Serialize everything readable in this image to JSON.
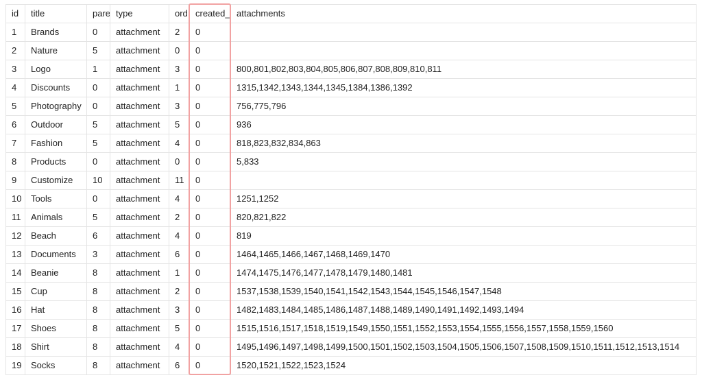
{
  "table": {
    "columns": [
      {
        "key": "id",
        "label": "id"
      },
      {
        "key": "title",
        "label": "title"
      },
      {
        "key": "parent",
        "label": "parent"
      },
      {
        "key": "type",
        "label": "type"
      },
      {
        "key": "ord",
        "label": "ord"
      },
      {
        "key": "created_by",
        "label": "created_by"
      },
      {
        "key": "attachments",
        "label": "attachments"
      }
    ],
    "rows": [
      {
        "id": "1",
        "title": "Brands",
        "parent": "0",
        "type": "attachment",
        "ord": "2",
        "created_by": "0",
        "attachments": ""
      },
      {
        "id": "2",
        "title": "Nature",
        "parent": "5",
        "type": "attachment",
        "ord": "0",
        "created_by": "0",
        "attachments": ""
      },
      {
        "id": "3",
        "title": "Logo",
        "parent": "1",
        "type": "attachment",
        "ord": "3",
        "created_by": "0",
        "attachments": "800,801,802,803,804,805,806,807,808,809,810,811"
      },
      {
        "id": "4",
        "title": "Discounts",
        "parent": "0",
        "type": "attachment",
        "ord": "1",
        "created_by": "0",
        "attachments": "1315,1342,1343,1344,1345,1384,1386,1392"
      },
      {
        "id": "5",
        "title": "Photography",
        "parent": "0",
        "type": "attachment",
        "ord": "3",
        "created_by": "0",
        "attachments": "756,775,796"
      },
      {
        "id": "6",
        "title": "Outdoor",
        "parent": "5",
        "type": "attachment",
        "ord": "5",
        "created_by": "0",
        "attachments": "936"
      },
      {
        "id": "7",
        "title": "Fashion",
        "parent": "5",
        "type": "attachment",
        "ord": "4",
        "created_by": "0",
        "attachments": "818,823,832,834,863"
      },
      {
        "id": "8",
        "title": "Products",
        "parent": "0",
        "type": "attachment",
        "ord": "0",
        "created_by": "0",
        "attachments": "5,833"
      },
      {
        "id": "9",
        "title": "Customize",
        "parent": "10",
        "type": "attachment",
        "ord": "11",
        "created_by": "0",
        "attachments": ""
      },
      {
        "id": "10",
        "title": "Tools",
        "parent": "0",
        "type": "attachment",
        "ord": "4",
        "created_by": "0",
        "attachments": "1251,1252"
      },
      {
        "id": "11",
        "title": "Animals",
        "parent": "5",
        "type": "attachment",
        "ord": "2",
        "created_by": "0",
        "attachments": "820,821,822"
      },
      {
        "id": "12",
        "title": "Beach",
        "parent": "6",
        "type": "attachment",
        "ord": "4",
        "created_by": "0",
        "attachments": "819"
      },
      {
        "id": "13",
        "title": "Documents",
        "parent": "3",
        "type": "attachment",
        "ord": "6",
        "created_by": "0",
        "attachments": "1464,1465,1466,1467,1468,1469,1470"
      },
      {
        "id": "14",
        "title": "Beanie",
        "parent": "8",
        "type": "attachment",
        "ord": "1",
        "created_by": "0",
        "attachments": "1474,1475,1476,1477,1478,1479,1480,1481"
      },
      {
        "id": "15",
        "title": "Cup",
        "parent": "8",
        "type": "attachment",
        "ord": "2",
        "created_by": "0",
        "attachments": "1537,1538,1539,1540,1541,1542,1543,1544,1545,1546,1547,1548"
      },
      {
        "id": "16",
        "title": "Hat",
        "parent": "8",
        "type": "attachment",
        "ord": "3",
        "created_by": "0",
        "attachments": "1482,1483,1484,1485,1486,1487,1488,1489,1490,1491,1492,1493,1494"
      },
      {
        "id": "17",
        "title": "Shoes",
        "parent": "8",
        "type": "attachment",
        "ord": "5",
        "created_by": "0",
        "attachments": "1515,1516,1517,1518,1519,1549,1550,1551,1552,1553,1554,1555,1556,1557,1558,1559,1560"
      },
      {
        "id": "18",
        "title": "Shirt",
        "parent": "8",
        "type": "attachment",
        "ord": "4",
        "created_by": "0",
        "attachments": "1495,1496,1497,1498,1499,1500,1501,1502,1503,1504,1505,1506,1507,1508,1509,1510,1511,1512,1513,1514"
      },
      {
        "id": "19",
        "title": "Socks",
        "parent": "8",
        "type": "attachment",
        "ord": "6",
        "created_by": "0",
        "attachments": "1520,1521,1522,1523,1524"
      }
    ]
  },
  "highlight_column": "created_by"
}
